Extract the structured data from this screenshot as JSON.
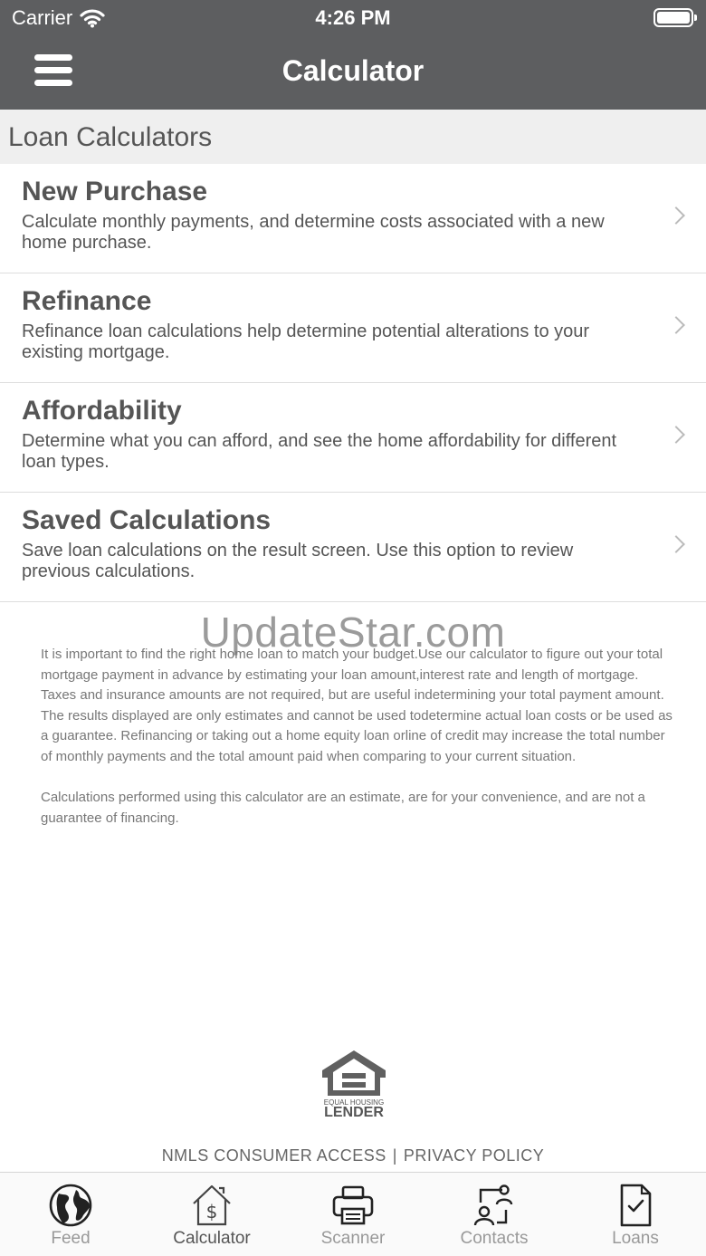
{
  "status_bar": {
    "carrier": "Carrier",
    "time": "4:26 PM"
  },
  "nav": {
    "title": "Calculator",
    "menu_icon": "hamburger-icon"
  },
  "section": {
    "header": "Loan Calculators"
  },
  "calculators": [
    {
      "title": "New Purchase",
      "description": "Calculate monthly payments, and determine costs associated with a new home purchase."
    },
    {
      "title": "Refinance",
      "description": "Refinance loan calculations help determine potential alterations to your existing mortgage."
    },
    {
      "title": "Affordability",
      "description": "Determine what you can afford, and see the home affordability for different loan types."
    },
    {
      "title": "Saved Calculations",
      "description": "Save loan calculations on the result screen. Use this option to review previous calculations."
    }
  ],
  "watermark": "UpdateStar.com",
  "disclaimer": {
    "paragraph1": "It is important to find the right home loan to match your budget.Use our calculator to figure out your total mortgage payment in advance by estimating your loan amount,interest rate and length of mortgage. Taxes and insurance amounts are not required, but are useful indetermining your total payment amount. The results displayed are only estimates and cannot be used todetermine actual loan costs or be used as a guarantee. Refinancing or taking out a home equity loan orline of credit may increase the total number of monthly payments and the total amount paid when comparing to your current situation.",
    "paragraph2": "Calculations performed using this calculator are an estimate, are for your convenience, and are not a guarantee of financing."
  },
  "equal_housing": {
    "small": "EQUAL HOUSING",
    "big": "LENDER"
  },
  "footer": {
    "nmls": "NMLS CONSUMER ACCESS",
    "separator": "|",
    "privacy": "PRIVACY POLICY"
  },
  "tabs": [
    {
      "label": "Feed",
      "icon": "globe-icon",
      "active": false
    },
    {
      "label": "Calculator",
      "icon": "house-dollar-icon",
      "active": true
    },
    {
      "label": "Scanner",
      "icon": "printer-icon",
      "active": false
    },
    {
      "label": "Contacts",
      "icon": "contacts-icon",
      "active": false
    },
    {
      "label": "Loans",
      "icon": "document-check-icon",
      "active": false
    }
  ]
}
